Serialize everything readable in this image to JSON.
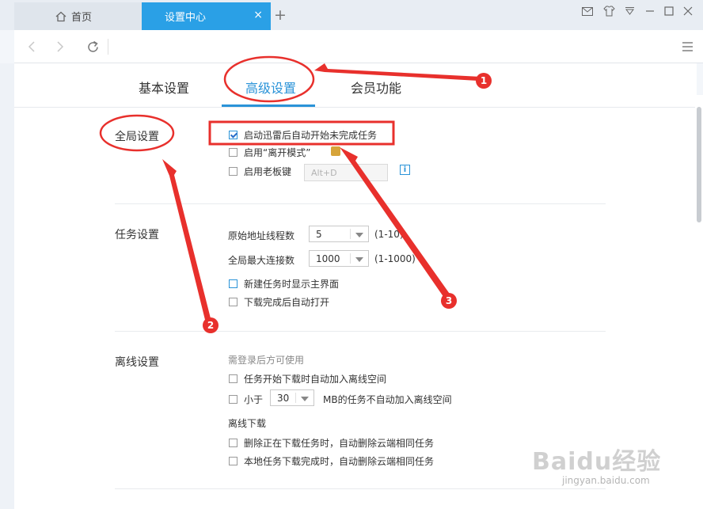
{
  "tabs": {
    "home_label": "首页",
    "active_label": "设置中心",
    "close_symbol": "×",
    "new_tab_symbol": "+"
  },
  "window_controls": [
    "mail-icon",
    "skin-icon",
    "menu-dropdown-icon",
    "minimize-icon",
    "maximize-icon",
    "close-icon"
  ],
  "nav": {
    "icons": [
      "back-icon",
      "forward-icon",
      "refresh-icon",
      "hamburger-menu-icon"
    ]
  },
  "settings_tabs": [
    {
      "label": "基本设置",
      "active": false
    },
    {
      "label": "高级设置",
      "active": true
    },
    {
      "label": "会员功能",
      "active": false
    }
  ],
  "global": {
    "title": "全局设置",
    "options": [
      {
        "label": "启动迅雷后自动开始未完成任务",
        "checked": true
      },
      {
        "label": "启用“离开模式”",
        "checked": false
      },
      {
        "label": "启用老板键",
        "checked": false
      }
    ],
    "hotkey_placeholder": "Alt+D",
    "info_symbol": "i"
  },
  "task": {
    "title": "任务设置",
    "thread_label": "原始地址线程数",
    "thread_value": "5",
    "thread_range": "(1-10)",
    "conn_label": "全局最大连接数",
    "conn_value": "1000",
    "conn_range": "(1-1000)",
    "options": [
      {
        "label": "新建任务时显示主界面",
        "checked": false
      },
      {
        "label": "下载完成后自动打开",
        "checked": false
      }
    ]
  },
  "offline": {
    "title": "离线设置",
    "hint": "需登录后方可使用",
    "opt_auto_add": "任务开始下载时自动加入离线空间",
    "less_than": "小于",
    "size_value": "30",
    "size_suffix": "MB的任务不自动加入离线空间",
    "sub_title": "离线下载",
    "opt_delete_downloading": "删除正在下载任务时，自动删除云端相同任务",
    "opt_delete_finished": "本地任务下载完成时，自动删除云端相同任务"
  },
  "annotations": {
    "n1": "1",
    "n2": "2",
    "n3": "3"
  },
  "colors": {
    "accent": "#2a93d8",
    "active_tab": "#2aa0e6",
    "annotation_red": "#e8302c"
  },
  "watermark": {
    "brand": "Baidu经验",
    "url": "jingyan.baidu.com"
  }
}
